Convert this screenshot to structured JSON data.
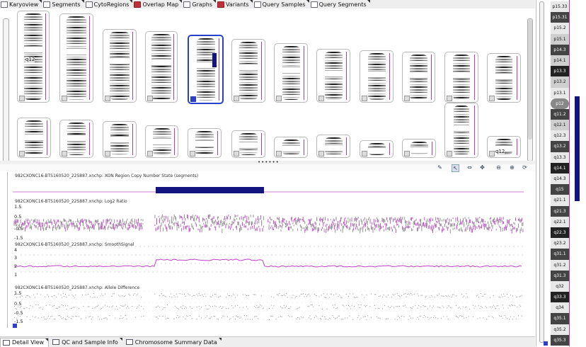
{
  "tabs": [
    {
      "label": "Karyoview",
      "icon": "karyoview-icon"
    },
    {
      "label": "Segments",
      "icon": "segments-icon"
    },
    {
      "label": "CytoRegions",
      "icon": "cytoregions-icon"
    },
    {
      "label": "Overlap Map",
      "icon": "overlap-map-icon"
    },
    {
      "label": "Graphs",
      "icon": "graphs-icon"
    },
    {
      "label": "Variants",
      "icon": "variants-icon"
    },
    {
      "label": "Query Samples",
      "icon": "query-samples-icon"
    },
    {
      "label": "Query Segments",
      "icon": "query-segments-icon"
    }
  ],
  "karyo": {
    "label_chr1": "q12",
    "label_chr19": "q12"
  },
  "tracks": {
    "t1": "982CXONC16-BTS160520_22S887.xnchp: XON Region Copy Number State (segments)",
    "t2": "982CXONC16-BTS160520_22S887.xnchp: Log2 Ratio",
    "t3": "982CXONC16-BTS160520_22S887.xnchp: SmoothSignal",
    "t4": "982CXONC16-BTS160520_22S887.xnchp: Allele Difference"
  },
  "ticks": {
    "log2": [
      "1.5",
      "0.5",
      "-0.5",
      "-1.5"
    ],
    "smooth": [
      "4",
      "3",
      "2",
      "1"
    ],
    "allele": [
      "1.5",
      "0.5",
      "-0.5",
      "-1.5"
    ]
  },
  "bottom_tabs": [
    {
      "label": "Detail View",
      "icon": "detail-view-icon"
    },
    {
      "label": "QC and Sample Info",
      "icon": "qc-sample-icon"
    },
    {
      "label": "Chromosome Summary Data",
      "icon": "chromosome-summary-icon"
    }
  ],
  "ideogram_bands": [
    "p15.33",
    "p15.31",
    "p15.2",
    "p15.1",
    "p14.3",
    "p14.1",
    "p13.3",
    "p13.2",
    "p13.1",
    "p12",
    "q11.2",
    "q12.1",
    "q12.3",
    "q13.2",
    "q13.3",
    "q14.1",
    "q14.3",
    "q15",
    "q21.1",
    "q21.3",
    "q22.1",
    "q22.3",
    "q23.2",
    "q31.1",
    "q31.2",
    "q31.3",
    "q32",
    "q33.3",
    "q34",
    "q35.1",
    "q35.2",
    "q35.3"
  ],
  "colors": {
    "accent": "#2b40c8",
    "cnv_bar": "#141480",
    "log2_magenta": "#c040c8",
    "log2_gray": "#888888"
  }
}
